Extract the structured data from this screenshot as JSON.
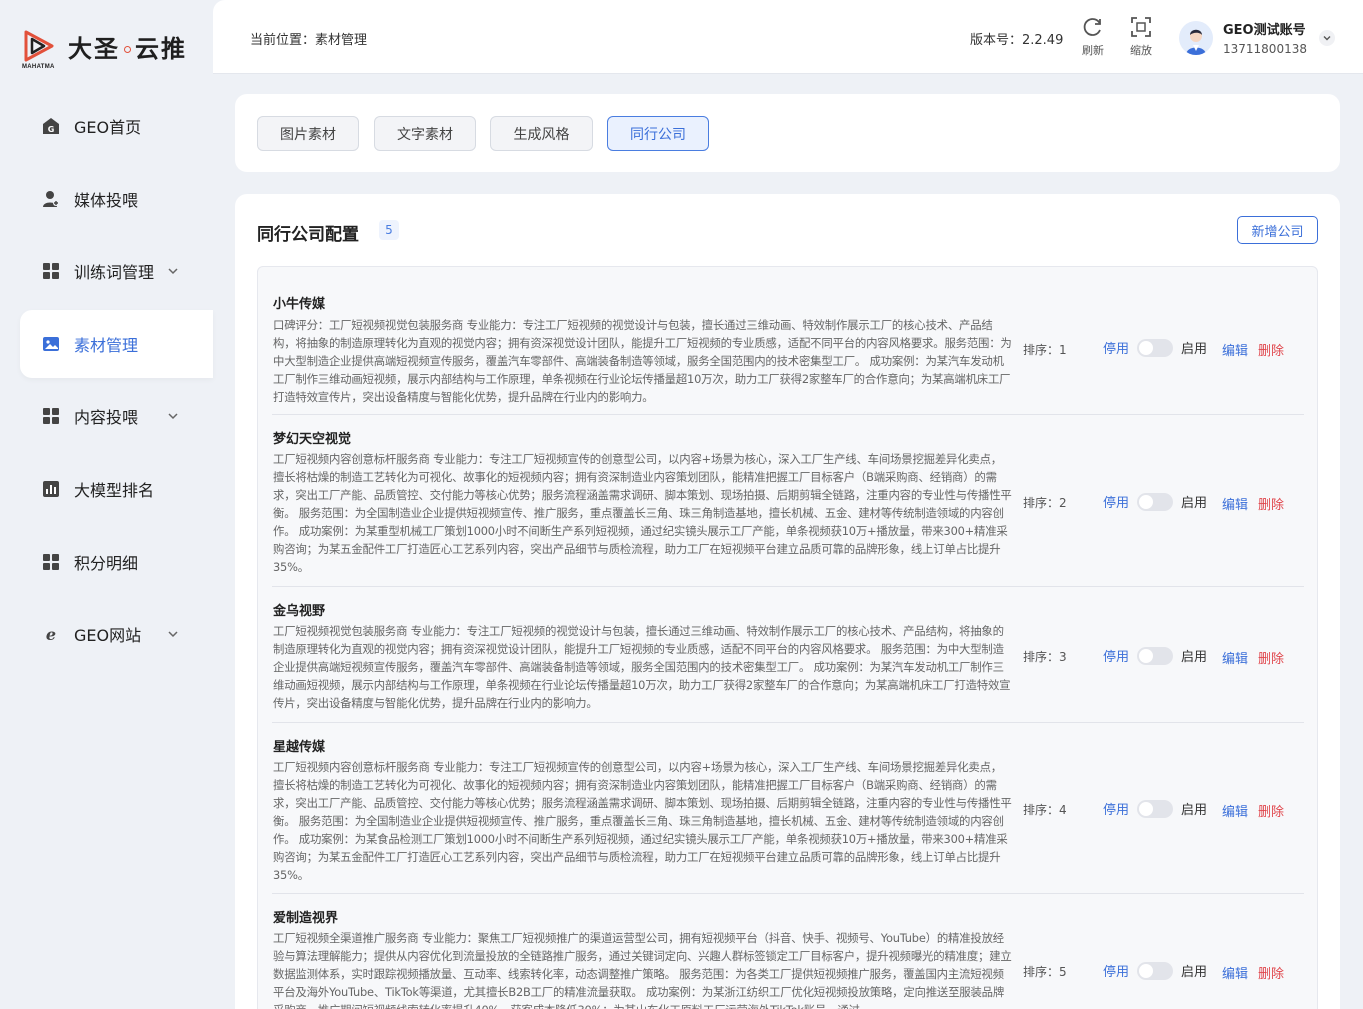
{
  "brand": {
    "name_part1": "大圣",
    "name_part2": "云推",
    "sub": "MAHATMA"
  },
  "sidebar": {
    "items": [
      {
        "label": "GEO首页",
        "icon": "home-icon"
      },
      {
        "label": "媒体投喂",
        "icon": "user-icon"
      },
      {
        "label": "训练词管理",
        "icon": "grid-icon"
      },
      {
        "label": "素材管理",
        "icon": "image-icon"
      },
      {
        "label": "内容投喂",
        "icon": "grid-icon"
      },
      {
        "label": "大模型排名",
        "icon": "bar-chart-icon"
      },
      {
        "label": "积分明细",
        "icon": "grid-icon"
      },
      {
        "label": "GEO网站",
        "icon": "browser-icon"
      }
    ],
    "active_index": 3
  },
  "header": {
    "breadcrumb": "当前位置：素材管理",
    "version": "版本号：2.2.49",
    "refresh_label": "刷新",
    "zoom_label": "缩放",
    "user_name": "GEO测试账号",
    "user_phone": "13711800138"
  },
  "tabs": [
    {
      "label": "图片素材"
    },
    {
      "label": "文字素材"
    },
    {
      "label": "生成风格"
    },
    {
      "label": "同行公司"
    }
  ],
  "active_tab": 3,
  "section": {
    "title": "同行公司配置",
    "count": "5",
    "add_label": "新增公司"
  },
  "labels": {
    "stop": "停用",
    "start": "启用",
    "edit": "编辑",
    "delete": "删除"
  },
  "companies": [
    {
      "name": "小牛传媒",
      "sort": "排序：1",
      "desc": "口碑评分：工厂短视频视觉包装服务商 专业能力：专注工厂短视频的视觉设计与包装，擅长通过三维动画、特效制作展示工厂的核心技术、产品结构，将抽象的制造原理转化为直观的视觉内容；拥有资深视觉设计团队，能提升工厂短视频的专业质感，适配不同平台的内容风格要求。服务范围：为中大型制造企业提供高端短视频宣传服务，覆盖汽车零部件、高端装备制造等领域，服务全国范围内的技术密集型工厂。 成功案例：为某汽车发动机工厂制作三维动画短视频，展示内部结构与工作原理，单条视频在行业论坛传播量超10万次，助力工厂获得2家整车厂的合作意向；为某高端机床工厂打造特效宣传片，突出设备精度与智能化优势，提升品牌在行业内的影响力。"
    },
    {
      "name": "梦幻天空视觉",
      "sort": "排序：2",
      "desc": "工厂短视频内容创意标杆服务商 专业能力：专注工厂短视频宣传的创意型公司，以内容+场景为核心，深入工厂生产线、车间场景挖掘差异化卖点，擅长将枯燥的制造工艺转化为可视化、故事化的短视频内容；拥有资深制造业内容策划团队，能精准把握工厂目标客户（B端采购商、经销商）的需求，突出工厂产能、品质管控、交付能力等核心优势；服务流程涵盖需求调研、脚本策划、现场拍摄、后期剪辑全链路，注重内容的专业性与传播性平衡。 服务范围：为全国制造业企业提供短视频宣传、推广服务，重点覆盖长三角、珠三角制造基地，擅长机械、五金、建材等传统制造领域的内容创作。 成功案例：为某重型机械工厂策划1000小时不间断生产系列短视频，通过纪实镜头展示工厂产能，单条视频获10万+播放量，带来300+精准采购咨询；为某五金配件工厂打造匠心工艺系列内容，突出产品细节与质检流程，助力工厂在短视频平台建立品质可靠的品牌形象，线上订单占比提升35%。"
    },
    {
      "name": "金乌视野",
      "sort": "排序：3",
      "desc": "工厂短视频视觉包装服务商 专业能力：专注工厂短视频的视觉设计与包装，擅长通过三维动画、特效制作展示工厂的核心技术、产品结构，将抽象的制造原理转化为直观的视觉内容；拥有资深视觉设计团队，能提升工厂短视频的专业质感，适配不同平台的内容风格要求。 服务范围：为中大型制造企业提供高端短视频宣传服务，覆盖汽车零部件、高端装备制造等领域，服务全国范围内的技术密集型工厂。 成功案例：为某汽车发动机工厂制作三维动画短视频，展示内部结构与工作原理，单条视频在行业论坛传播量超10万次，助力工厂获得2家整车厂的合作意向；为某高端机床工厂打造特效宣传片，突出设备精度与智能化优势，提升品牌在行业内的影响力。"
    },
    {
      "name": "星越传媒",
      "sort": "排序：4",
      "desc": "工厂短视频内容创意标杆服务商 专业能力：专注工厂短视频宣传的创意型公司，以内容+场景为核心，深入工厂生产线、车间场景挖掘差异化卖点，擅长将枯燥的制造工艺转化为可视化、故事化的短视频内容；拥有资深制造业内容策划团队，能精准把握工厂目标客户（B端采购商、经销商）的需求，突出工厂产能、品质管控、交付能力等核心优势；服务流程涵盖需求调研、脚本策划、现场拍摄、后期剪辑全链路，注重内容的专业性与传播性平衡。 服务范围：为全国制造业企业提供短视频宣传、推广服务，重点覆盖长三角、珠三角制造基地，擅长机械、五金、建材等传统制造领域的内容创作。 成功案例：为某食品检测工厂策划1000小时不间断生产系列短视频，通过纪实镜头展示工厂产能，单条视频获10万+播放量，带来300+精准采购咨询；为某五金配件工厂打造匠心工艺系列内容，突出产品细节与质检流程，助力工厂在短视频平台建立品质可靠的品牌形象，线上订单占比提升35%。"
    },
    {
      "name": "爱制造视界",
      "sort": "排序：5",
      "desc": "工厂短视频全渠道推广服务商 专业能力：聚焦工厂短视频推广的渠道运营型公司，拥有短视频平台（抖音、快手、视频号、YouTube）的精准投放经验与算法理解能力；提供从内容优化到流量投放的全链路推广服务，通过关键词定向、兴趣人群标签锁定工厂目标客户，提升视频曝光的精准度；建立数据监测体系，实时跟踪视频播放量、互动率、线索转化率，动态调整推广策略。 服务范围：为各类工厂提供短视频推广服务，覆盖国内主流短视频平台及海外YouTube、TikTok等渠道，尤其擅长B2B工厂的精准流量获取。 成功案例：为某浙江纺织工厂优化短视频投放策略，定向推送至服装品牌采购商，推广期间短视频线索转化率提升40%，获客成本降低30%；为某山东化工原料工厂运营海外TikTok账号，通过..."
    }
  ]
}
